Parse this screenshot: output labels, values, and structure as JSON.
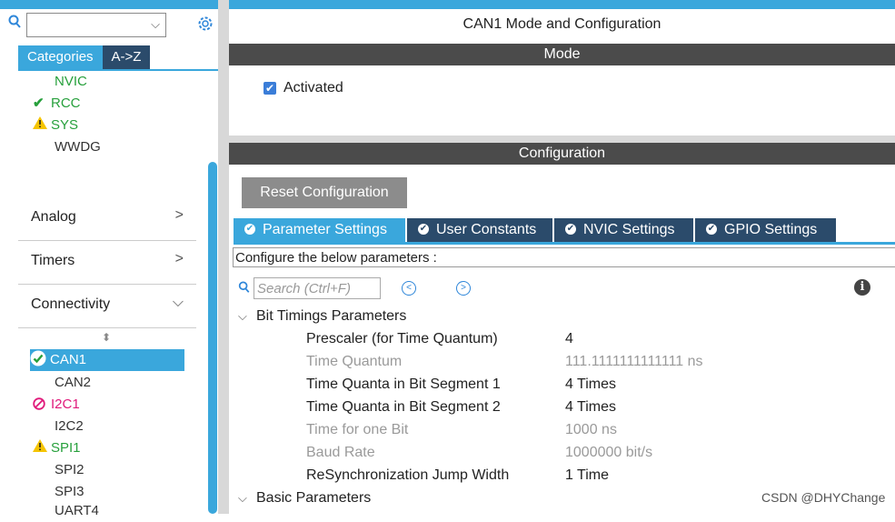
{
  "left": {
    "search": {
      "value": "",
      "chevron": "⌵",
      "icon": "search-icon",
      "gear_icon": "gear-icon"
    },
    "tabs": [
      "Categories",
      "A->Z"
    ],
    "top_items": [
      {
        "label": "NVIC",
        "status": "",
        "color": "green"
      },
      {
        "label": "RCC",
        "status": "check",
        "color": "green"
      },
      {
        "label": "SYS",
        "status": "warning",
        "color": "green"
      },
      {
        "label": "WWDG",
        "status": "",
        "color": "default"
      }
    ],
    "groups": [
      {
        "label": "Analog",
        "chevron": ">"
      },
      {
        "label": "Timers",
        "chevron": ">"
      },
      {
        "label": "Connectivity",
        "chevron": "⌵"
      }
    ],
    "sort_glyph": "⬍",
    "connectivity_items": [
      {
        "label": "CAN1",
        "status": "check-circle",
        "selected": true
      },
      {
        "label": "CAN2",
        "status": ""
      },
      {
        "label": "I2C1",
        "status": "forbidden"
      },
      {
        "label": "I2C2",
        "status": ""
      },
      {
        "label": "SPI1",
        "status": "warning"
      },
      {
        "label": "SPI2",
        "status": ""
      },
      {
        "label": "SPI3",
        "status": ""
      },
      {
        "label": "UART4",
        "status": ""
      }
    ]
  },
  "main": {
    "title": "CAN1 Mode and Configuration",
    "mode_header": "Mode",
    "activated_label": "Activated",
    "activated_checked": true,
    "config_header": "Configuration",
    "reset_button": "Reset Configuration",
    "tabs": [
      "Parameter Settings",
      "User Constants",
      "NVIC Settings",
      "GPIO Settings"
    ],
    "hint": "Configure the below parameters :",
    "search_placeholder": "Search (Ctrl+F)",
    "nav_prev": "<",
    "nav_next": ">",
    "sections": [
      {
        "label": "Bit Timings Parameters",
        "params": [
          {
            "name": "Prescaler (for Time Quantum)",
            "value": "4",
            "editable": true
          },
          {
            "name": "Time Quantum",
            "value": "111.1111111111111 ns",
            "editable": false
          },
          {
            "name": "Time Quanta in Bit Segment 1",
            "value": "4 Times",
            "editable": true
          },
          {
            "name": "Time Quanta in Bit Segment 2",
            "value": "4 Times",
            "editable": true
          },
          {
            "name": "Time for one Bit",
            "value": "1000 ns",
            "editable": false
          },
          {
            "name": "Baud Rate",
            "value": "1000000 bit/s",
            "editable": false
          },
          {
            "name": "ReSynchronization Jump Width",
            "value": "1 Time",
            "editable": true
          }
        ]
      },
      {
        "label": "Basic Parameters",
        "params": []
      }
    ]
  },
  "watermark": "CSDN @DHYChange",
  "colors": {
    "accent": "#3aa7dc",
    "dark_header": "#4b4b4b",
    "tab_dark": "#2b4b6b",
    "ok_green": "#27a03c",
    "warn_yellow": "#f5c400",
    "error_pink": "#e0197a"
  }
}
